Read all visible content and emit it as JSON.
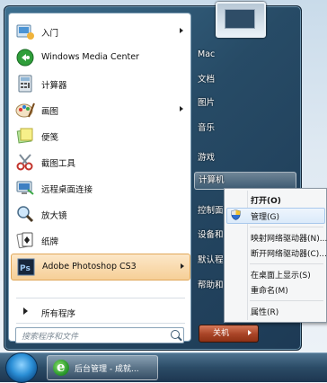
{
  "start_menu": {
    "left_items": [
      {
        "label": "入门",
        "icon": "getting-started-icon",
        "submenu": true
      },
      {
        "label": "Windows Media Center",
        "icon": "media-center-icon",
        "submenu": false
      },
      {
        "label": "计算器",
        "icon": "calculator-icon",
        "submenu": false
      },
      {
        "label": "画图",
        "icon": "paint-icon",
        "submenu": true
      },
      {
        "label": "便笺",
        "icon": "sticky-notes-icon",
        "submenu": false
      },
      {
        "label": "截图工具",
        "icon": "snipping-tool-icon",
        "submenu": false
      },
      {
        "label": "远程桌面连接",
        "icon": "remote-desktop-icon",
        "submenu": false
      },
      {
        "label": "放大镜",
        "icon": "magnifier-icon",
        "submenu": false
      },
      {
        "label": "纸牌",
        "icon": "solitaire-icon",
        "submenu": false
      },
      {
        "label": "Adobe Photoshop CS3",
        "icon": "photoshop-icon",
        "submenu": true,
        "selected": true
      }
    ],
    "all_programs": "所有程序",
    "search_placeholder": "搜索程序和文件",
    "right_items": [
      "Mac",
      "文档",
      "图片",
      "音乐",
      "游戏",
      "计算机",
      "控制面",
      "设备和",
      "默认程",
      "帮助和"
    ],
    "shutdown": "关机"
  },
  "context_menu": {
    "items": [
      {
        "label": "打开(O)",
        "bold": true
      },
      {
        "label": "管理(G)",
        "icon": "uac-shield-icon"
      },
      {
        "label": "映射网络驱动器(N)..."
      },
      {
        "label": "断开网络驱动器(C)..."
      },
      {
        "label": "在桌面上显示(S)"
      },
      {
        "label": "重命名(M)"
      },
      {
        "label": "属性(R)"
      }
    ]
  },
  "taskbar": {
    "active_window": "后台管理 - 成就..."
  },
  "colors": {
    "menu_dark": "#274b66",
    "selection": "#f6cf97",
    "shutdown": "#a84326"
  }
}
